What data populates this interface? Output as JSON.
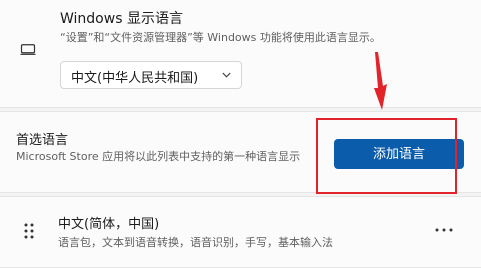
{
  "display_language": {
    "title": "Windows 显示语言",
    "description": "“设置”和“文件资源管理器”等 Windows 功能将使用此语言显示。",
    "selected": "中文(中华人民共和国)",
    "icon": "monitor-icon"
  },
  "preferred_languages": {
    "title": "首选语言",
    "description": "Microsoft Store 应用将以此列表中支持的第一种语言显示",
    "add_button_label": "添加语言"
  },
  "language_item": {
    "title": "中文(简体，中国)",
    "features": "语言包，文本到语音转换，语音识别，手写，基本输入法"
  },
  "annotation": {
    "color": "#e2232a"
  },
  "colors": {
    "accent": "#0b5cab"
  }
}
